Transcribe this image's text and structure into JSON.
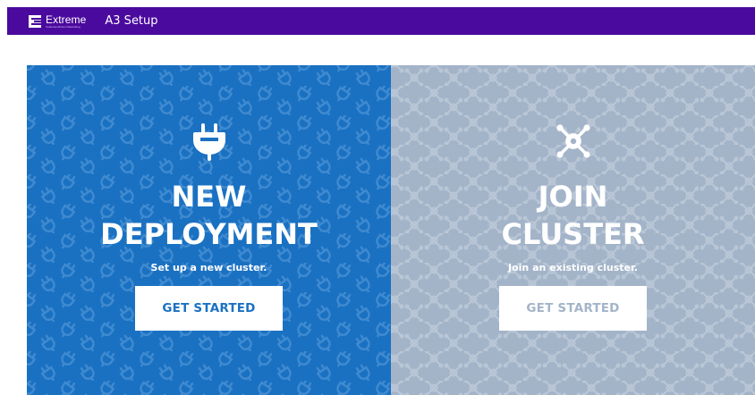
{
  "header": {
    "brand_name": "Extreme",
    "brand_tagline": "Customer-Driven Networking",
    "app_title": "A3 Setup"
  },
  "panels": [
    {
      "id": "new-deployment",
      "icon": "plug-icon",
      "pattern_icon": "plug-icon",
      "title": "NEW\nDEPLOYMENT",
      "subtitle": "Set up a new cluster.",
      "button_label": "GET STARTED",
      "background": "#1a71c2"
    },
    {
      "id": "join-cluster",
      "icon": "cluster-icon",
      "pattern_icon": "cluster-icon",
      "title": "JOIN\nCLUSTER",
      "subtitle": "Join an existing cluster.",
      "button_label": "GET STARTED",
      "background": "#a3b4c9"
    }
  ],
  "colors": {
    "header_bg": "#4b0a9e",
    "accent_blue": "#1a71c2",
    "muted_gray_blue": "#a3b4c9",
    "white": "#ffffff"
  }
}
